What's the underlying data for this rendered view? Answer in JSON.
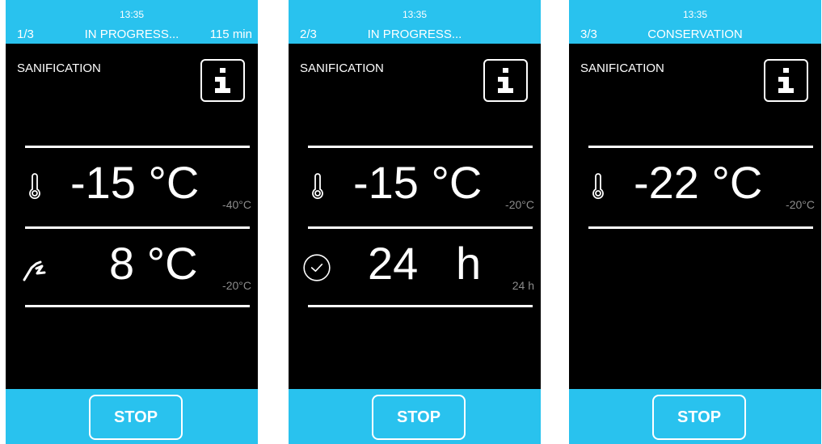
{
  "colors": {
    "accent": "#29c2ee",
    "background": "#000000",
    "text": "#ffffff",
    "setpoint": "#8c8c8c"
  },
  "panels": [
    {
      "time": "13:35",
      "step": "1/3",
      "status": "IN PROGRESS...",
      "duration": "115 min",
      "program": "SANIFICATION",
      "info_icon": "info-icon",
      "rows": [
        {
          "icon": "thermometer-icon",
          "value": "-15 °C",
          "setpoint": "-40°C"
        },
        {
          "icon": "probe-icon",
          "value": "8 °C",
          "setpoint": "-20°C"
        }
      ],
      "stop_label": "STOP"
    },
    {
      "time": "13:35",
      "step": "2/3",
      "status": "IN PROGRESS...",
      "program": "SANIFICATION",
      "info_icon": "info-icon",
      "rows": [
        {
          "icon": "thermometer-icon",
          "value": "-15 °C",
          "setpoint": "-20°C"
        },
        {
          "icon": "clock-icon",
          "value": "24   h",
          "setpoint": "24 h"
        }
      ],
      "stop_label": "STOP"
    },
    {
      "time": "13:35",
      "step": "3/3",
      "status": "CONSERVATION",
      "program": "SANIFICATION",
      "info_icon": "info-icon",
      "rows": [
        {
          "icon": "thermometer-icon",
          "value": "-22 °C",
          "setpoint": "-20°C"
        }
      ],
      "stop_label": "STOP"
    }
  ]
}
